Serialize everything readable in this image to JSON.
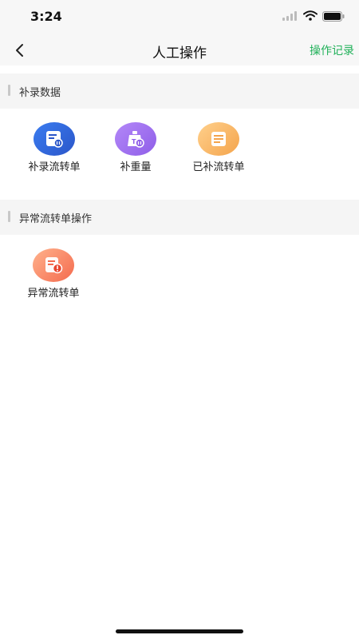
{
  "status_bar": {
    "time": "3:24"
  },
  "nav": {
    "title": "人工操作",
    "action_label": "操作记录"
  },
  "sections": [
    {
      "title": "补录数据",
      "items": [
        {
          "label": "补录流转单",
          "icon": "document-add-icon",
          "color": "#2b56c9"
        },
        {
          "label": "补重量",
          "icon": "weight-icon",
          "color": "#8f5ee8"
        },
        {
          "label": "已补流转单",
          "icon": "document-done-icon",
          "color": "#f4a44c"
        }
      ]
    },
    {
      "title": "异常流转单操作",
      "items": [
        {
          "label": "异常流转单",
          "icon": "document-alert-icon",
          "color": "#f46a4e"
        }
      ]
    }
  ],
  "colors": {
    "accent": "#21b15a",
    "header_bg": "#f7f7f7",
    "section_bg": "#f5f5f5"
  }
}
